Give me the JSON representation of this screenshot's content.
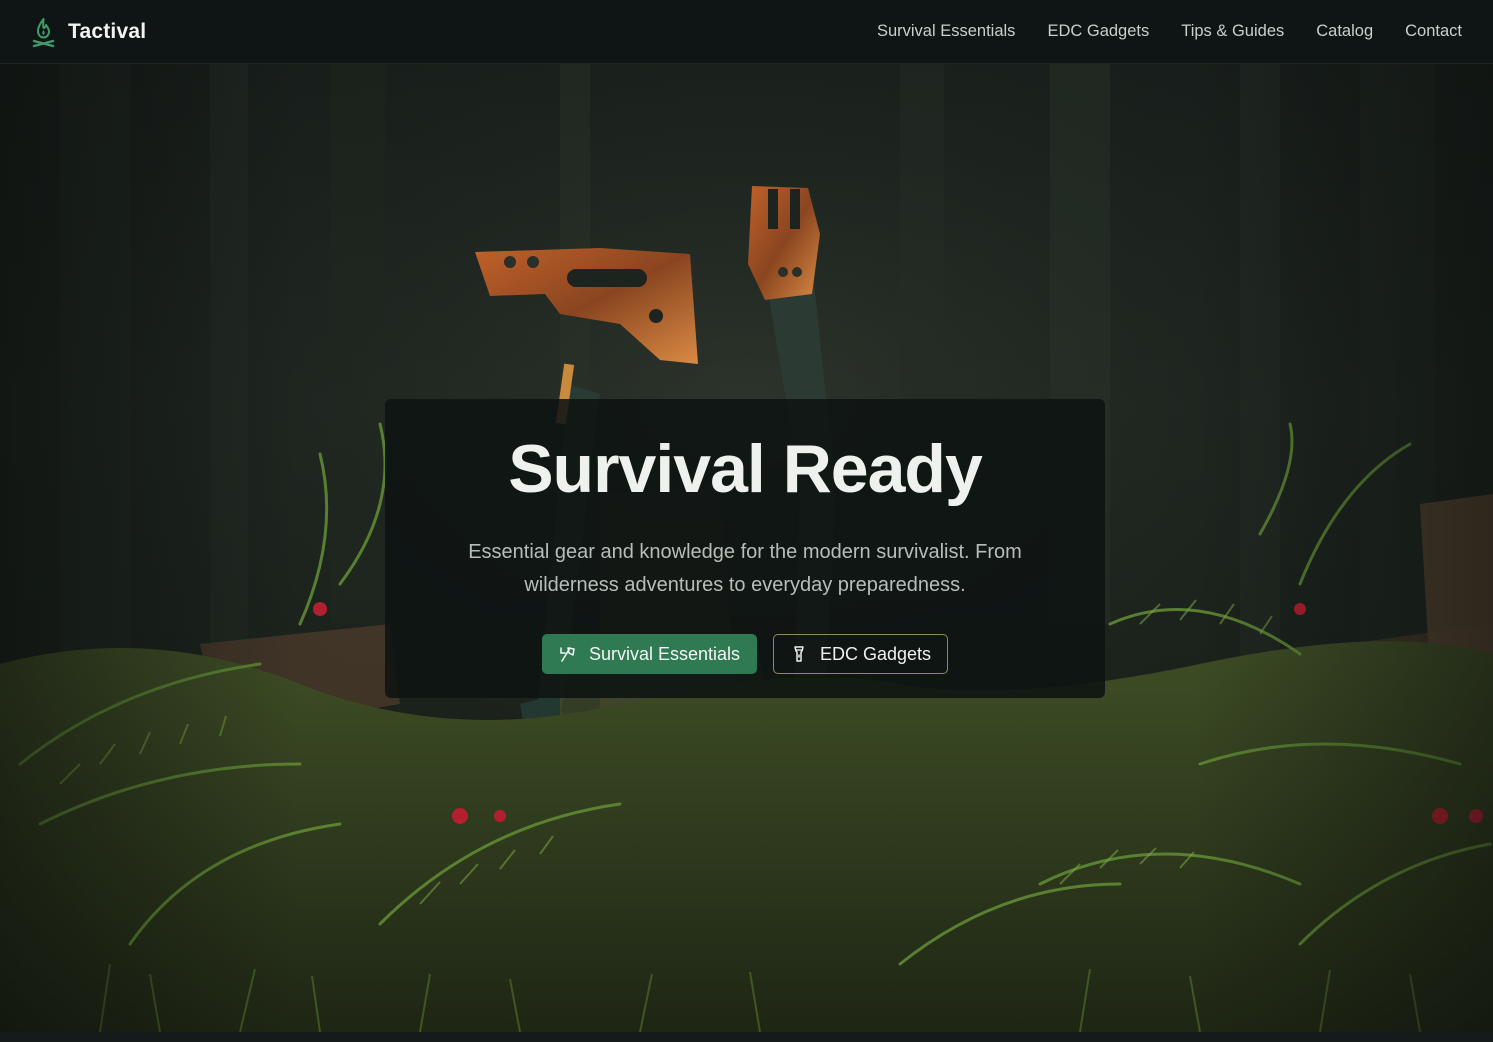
{
  "brand": {
    "name": "Tactival",
    "icon": "campfire-icon",
    "accent": "#3f9b6a"
  },
  "nav": {
    "items": [
      "Survival Essentials",
      "EDC Gadgets",
      "Tips & Guides",
      "Catalog",
      "Contact"
    ]
  },
  "hero": {
    "title": "Survival Ready",
    "subtitle": "Essential gear and knowledge for the modern survivalist. From wilderness adventures to everyday preparedness.",
    "primary_button": {
      "label": "Survival Essentials",
      "icon": "axe-icon",
      "color": "#2f7a52"
    },
    "secondary_button": {
      "label": "EDC Gadgets",
      "icon": "flashlight-icon",
      "border": "#8c8a5e"
    },
    "background": "forest-scene-with-tactical-axes"
  }
}
